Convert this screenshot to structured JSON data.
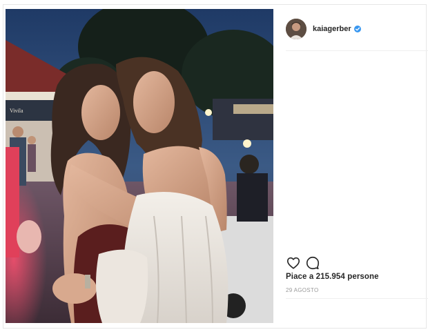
{
  "post": {
    "username": "kaiagerber",
    "verified": true,
    "likes_text": "Piace a 215.954 persone",
    "date_text": "29 AGOSTO",
    "photo_sign_text": "Vivila"
  },
  "icons": {
    "like": "heart-outline-icon",
    "comment": "comment-bubble-icon",
    "verified": "verified-badge-icon"
  },
  "colors": {
    "username": "#262626",
    "verified": "#3897f0",
    "date": "#999999",
    "divider": "#efefef"
  }
}
